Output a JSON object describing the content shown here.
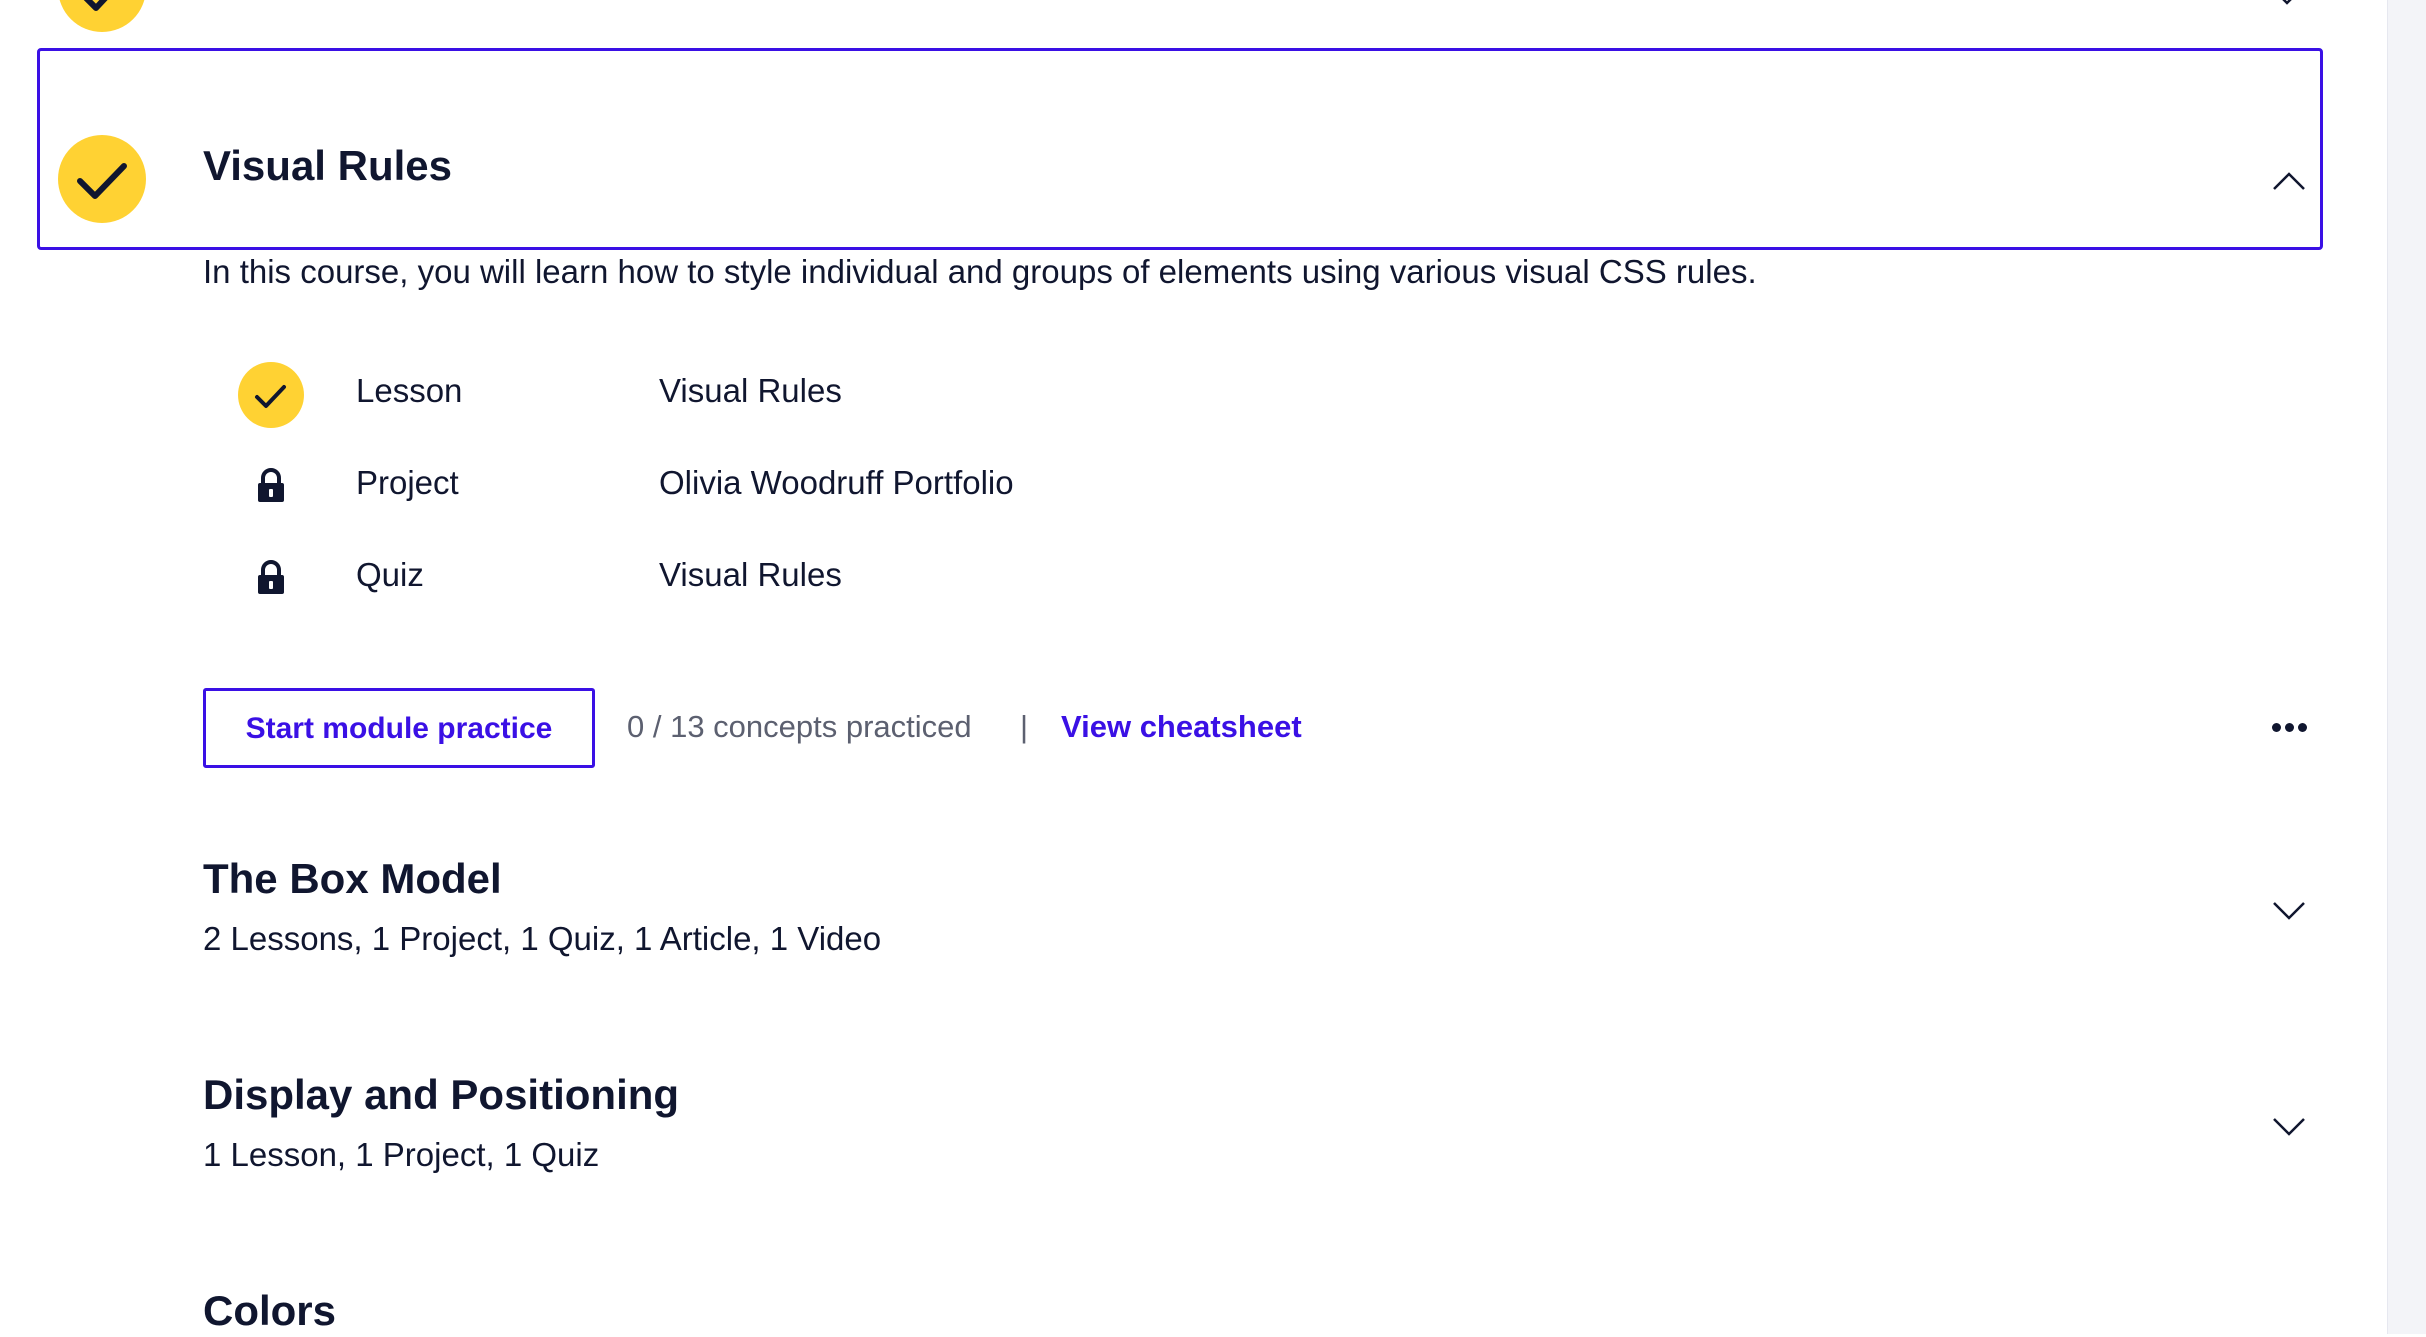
{
  "module": {
    "title": "Visual Rules",
    "description": "In this course, you will learn how to style individual and groups of elements using various visual CSS rules.",
    "status": "completed",
    "items": [
      {
        "type": "Lesson",
        "name": "Visual Rules",
        "status": "completed",
        "icon": "check-icon"
      },
      {
        "type": "Project",
        "name": "Olivia Woodruff Portfolio",
        "status": "locked",
        "icon": "lock-icon"
      },
      {
        "type": "Quiz",
        "name": "Visual Rules",
        "status": "locked",
        "icon": "lock-icon"
      }
    ],
    "practice_button": "Start module practice",
    "concepts_practiced": "0 / 13 concepts practiced",
    "separator": "|",
    "cheatsheet_link": "View cheatsheet",
    "more_icon": "more-options-icon"
  },
  "sections": [
    {
      "title": "The Box Model",
      "summary": "2 Lessons, 1 Project, 1 Quiz, 1 Article, 1 Video"
    },
    {
      "title": "Display and Positioning",
      "summary": "1 Lesson, 1 Project, 1 Quiz"
    },
    {
      "title": "Colors",
      "summary": ""
    }
  ],
  "colors": {
    "accent": "#3a10e5",
    "check": "#ffd233",
    "text": "#10162f",
    "muted": "#5c6070"
  }
}
